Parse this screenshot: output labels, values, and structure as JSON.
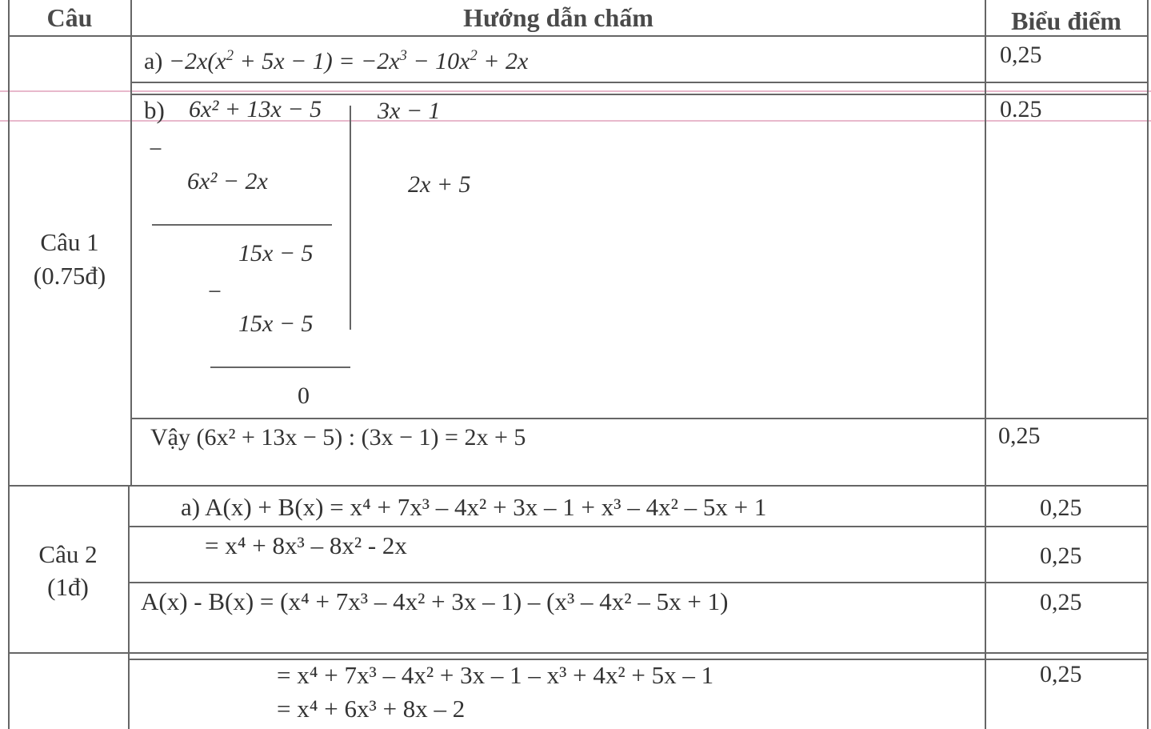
{
  "header": {
    "col1": "Câu",
    "col2": "Hướng dẫn chấm",
    "col3": "Biểu điểm"
  },
  "q1": {
    "label": "Câu 1",
    "points": "(0.75đ)",
    "a": {
      "prefix": "a)",
      "lhs": "−2x(x",
      "exp": "2",
      "rest": " + 5x − 1) = −2x",
      "exp2": "3",
      "rest2": " − 10x",
      "exp3": "2",
      "rest3": " + 2x",
      "score": "0,25"
    },
    "b": {
      "prefix": "b)",
      "dividend": "6x² + 13x − 5",
      "divisor": "3x − 1",
      "minus1": "−",
      "sub1": "6x² − 2x",
      "quotient": "2x + 5",
      "rem1": "15x − 5",
      "minus2": "−",
      "sub2": "15x − 5",
      "rem2": "0",
      "score": "0.25"
    },
    "conclusion": {
      "text": "Vậy (6x² + 13x − 5) : (3x − 1) = 2x + 5",
      "score": "0,25"
    }
  },
  "q2": {
    "label": "Câu 2",
    "points": "(1đ)",
    "a1": {
      "text": "a)  A(x) + B(x) = x⁴ + 7x³ – 4x² + 3x – 1 + x³ – 4x² – 5x + 1",
      "score": "0,25"
    },
    "a2": {
      "text": "= x⁴ + 8x³ – 8x² - 2x",
      "score": "0,25"
    },
    "b1": {
      "text": "A(x) - B(x) = (x⁴ + 7x³ – 4x² + 3x – 1) – (x³ – 4x² – 5x + 1)",
      "score": "0,25"
    },
    "b2": {
      "text": "= x⁴ + 7x³ – 4x² + 3x – 1 – x³ + 4x² + 5x – 1",
      "score": "0,25"
    },
    "b3": {
      "text": "= x⁴ + 6x³  + 8x – 2"
    }
  }
}
